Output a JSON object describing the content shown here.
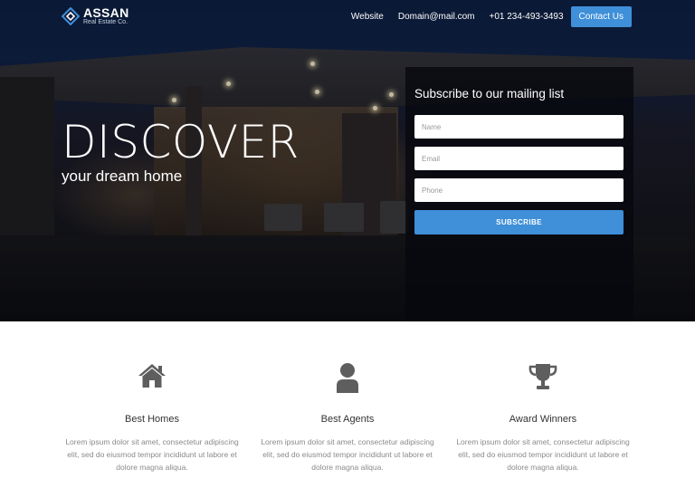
{
  "colors": {
    "accent": "#3f8fd9",
    "icon": "#5e5e5e"
  },
  "brand": {
    "name": "ASSAN",
    "tagline": "Real Estate Co."
  },
  "nav": {
    "links": [
      "Website",
      "Domain@mail.com",
      "+01 234-493-3493"
    ],
    "cta": "Contact Us"
  },
  "hero": {
    "title": "DISCOVER",
    "subtitle": "your dream home"
  },
  "subscribe": {
    "title": "Subscribe to our mailing list",
    "name_placeholder": "Name",
    "email_placeholder": "Email",
    "phone_placeholder": "Phone",
    "button": "SUBSCRIBE"
  },
  "features": [
    {
      "icon": "home-icon",
      "title": "Best Homes",
      "text": "Lorem ipsum dolor sit amet, consectetur adipiscing elit, sed do eiusmod tempor incididunt ut labore et dolore magna aliqua."
    },
    {
      "icon": "user-icon",
      "title": "Best Agents",
      "text": "Lorem ipsum dolor sit amet, consectetur adipiscing elit, sed do eiusmod tempor incididunt ut labore et dolore magna aliqua."
    },
    {
      "icon": "trophy-icon",
      "title": "Award Winners",
      "text": "Lorem ipsum dolor sit amet, consectetur adipiscing elit, sed do eiusmod tempor incididunt ut labore et dolore magna aliqua."
    }
  ]
}
